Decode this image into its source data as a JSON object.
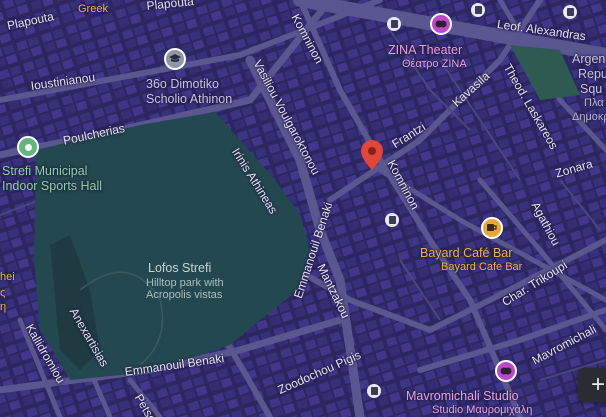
{
  "streets": {
    "plapouta_left": "Plapouta",
    "plapouta_top": "Plapouta",
    "ioustinianou": "Ioustinianou",
    "poulcherias": "Poulcherias",
    "vasiliou": "Vasiliou Voulgaroktonou",
    "komninon_top": "Komninon",
    "komninon_mid": "Komninon",
    "frantzi": "Frantzi",
    "kavasila": "Kavasila",
    "leof_alexandras": "Leof. Alexandras",
    "theod_laskareos": "Theod. Laskareos",
    "zonara": "Zonara",
    "agathiou": "Agathiou",
    "irinis_athineas": "Irinis Athineas",
    "emmanouil_benaki_vert": "Emmanouil Benaki",
    "emmanouil_benaki_bottom": "Emmanouil Benaki",
    "mantzakou": "Mantzakou",
    "zoodochou_pigis": "Zoodochou Pigis",
    "char_trikoupi": "Char. Trikoupi",
    "mavromichali": "Mavromichali",
    "kallidromiou": "Kallidromiou",
    "anexartisias": "Anexartisias",
    "petso": "Petso"
  },
  "places": {
    "greek_top": "Greek",
    "dimotiko_line1": "36o Dimotiko",
    "dimotiko_line2": "Scholio Athinon",
    "strefi_hall_line1": "Strefi Municipal",
    "strefi_hall_line2": "Indoor Sports Hall",
    "zina_theater": "ZINA Theater",
    "zina_theater_greek": "Θέατρο ΖΙΝΑ",
    "lofos_strefi": "Lofos Strefi",
    "lofos_sub_line1": "Hilltop park with",
    "lofos_sub_line2": "Acropolis vistas",
    "bayard_cafe": "Bayard Café Bar",
    "bayard_cafe_sub": "Bayard Cafe Bar",
    "mavromichali_studio": "Mavromichali Studio",
    "mavromichali_studio_greek": "Studio Μαυρομιχάλη",
    "argentina_line1": "Argen",
    "argentina_line2": "Repu",
    "argentina_line3": "Squ",
    "argentina_greek1": "Πλα",
    "argentina_greek2": "Δημοκρ",
    "left_edge_1": "hei",
    "left_edge_2": "ς",
    "left_edge_3": "η"
  },
  "controls": {
    "zoom_in": "+"
  },
  "colors": {
    "block_fill": "#3d3380",
    "road": "#575386",
    "park": "#24484f",
    "pin_red": "#e0463a",
    "school_pin": "#8f96a6",
    "sports_pin": "#62b57f",
    "cafe_pin": "#e6a83a",
    "theater_pin": "#c048c8"
  }
}
